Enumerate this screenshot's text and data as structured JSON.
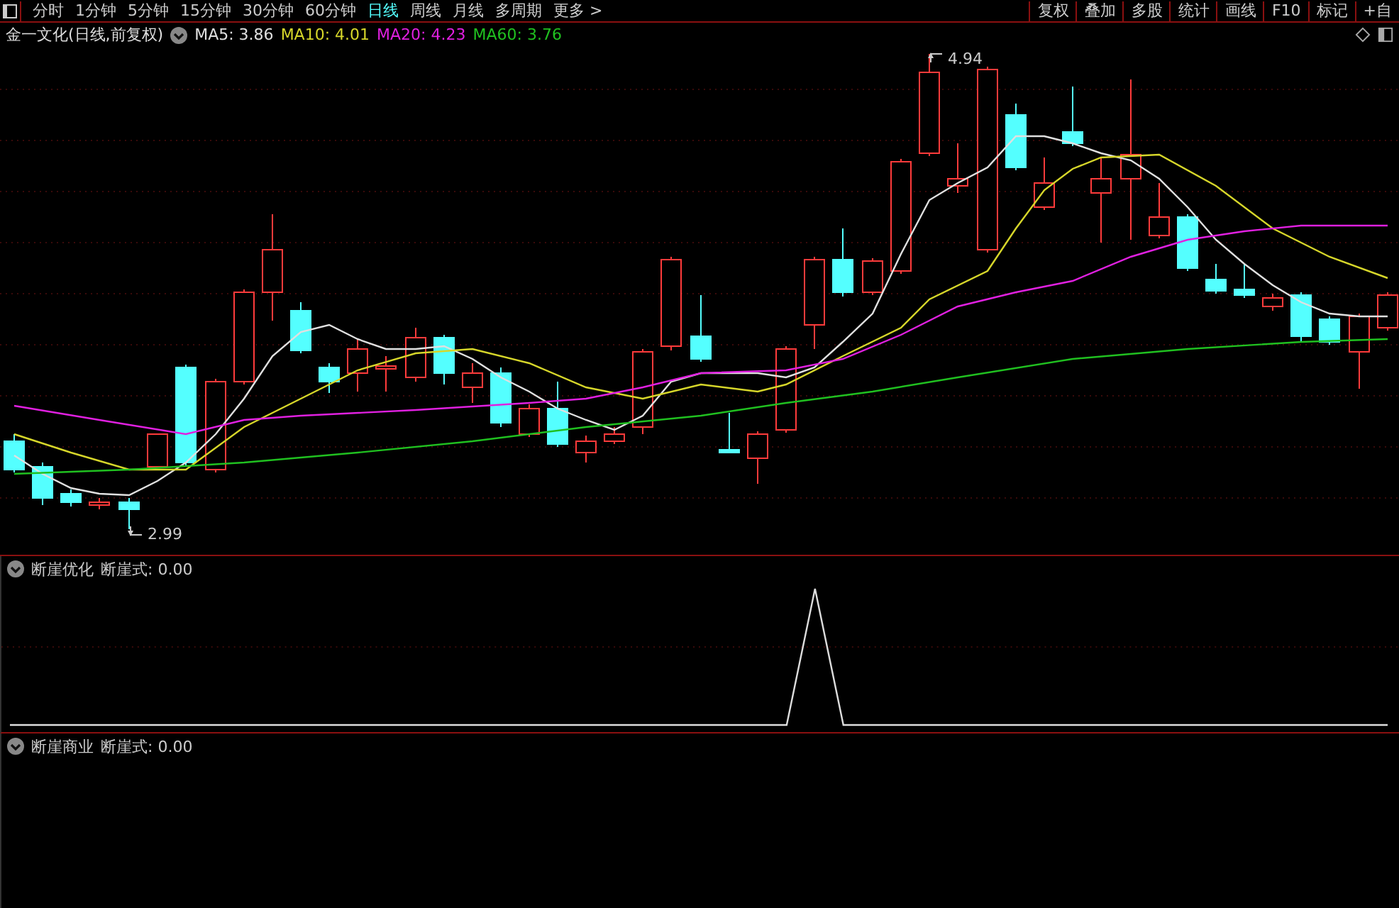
{
  "toolbar": {
    "periods": [
      {
        "label": "分时",
        "selected": false
      },
      {
        "label": "1分钟",
        "selected": false
      },
      {
        "label": "5分钟",
        "selected": false
      },
      {
        "label": "15分钟",
        "selected": false
      },
      {
        "label": "30分钟",
        "selected": false
      },
      {
        "label": "60分钟",
        "selected": false
      },
      {
        "label": "日线",
        "selected": true
      },
      {
        "label": "周线",
        "selected": false
      },
      {
        "label": "月线",
        "selected": false
      },
      {
        "label": "多周期",
        "selected": false
      },
      {
        "label": "更多 >",
        "selected": false
      }
    ],
    "buttons": [
      "复权",
      "叠加",
      "多股",
      "统计",
      "画线",
      "F10",
      "标记",
      "+自"
    ]
  },
  "main_chart": {
    "title": "金一文化(日线,前复权)",
    "moving_averages": [
      {
        "label": "MA5: 3.86",
        "color": "#e0e0e0"
      },
      {
        "label": "MA10: 4.01",
        "color": "#d6d62a"
      },
      {
        "label": "MA20: 4.23",
        "color": "#e020e0"
      },
      {
        "label": "MA60: 3.76",
        "color": "#20c020"
      }
    ],
    "high_label": "4.94",
    "low_label": "2.99"
  },
  "indicators": [
    {
      "title": "断崖优化",
      "value": "断崖式: 0.00"
    },
    {
      "title": "断崖商业",
      "value": "断崖式: 0.00"
    }
  ]
}
